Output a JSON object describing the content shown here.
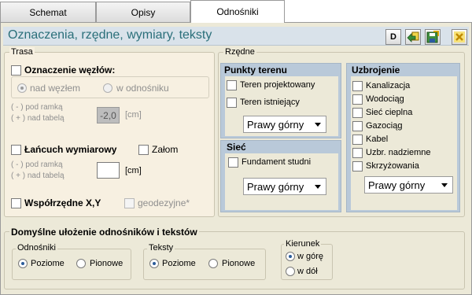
{
  "tabs": [
    {
      "label": "Schemat"
    },
    {
      "label": "Opisy"
    },
    {
      "label": "Odnośniki"
    }
  ],
  "header": {
    "title": "Oznaczenia, rzędne, wymiary, teksty",
    "btn_d": "D"
  },
  "trasa": {
    "label": "Trasa",
    "oznaczenie": "Oznaczenie węzłów:",
    "nad_wezlem": "nad węzłem",
    "w_odnosniku": "w odnośniku",
    "pod_ramka": "( - ) pod ramką",
    "nad_tabela": "( + ) nad tabelą",
    "value": "-2,0",
    "unit": "[cm]",
    "lancuch": "Łańcuch wymiarowy",
    "zalom": "Załom",
    "pod_ramka2": "( - ) pod ramką",
    "nad_tabela2": "( + ) nad tabelą",
    "value2": "",
    "unit2": "[cm]",
    "wspolrzedne": "Współrzędne X,Y",
    "geodezyjne": "geodezyjne*"
  },
  "rzedne": {
    "label": "Rzędne",
    "punkty": {
      "title": "Punkty terenu",
      "items": [
        "Teren projektowany",
        "Teren istniejący"
      ],
      "select": "Prawy górny"
    },
    "siec": {
      "title": "Sieć",
      "items": [
        "Fundament studni"
      ],
      "select": "Prawy górny"
    },
    "uzbrojenie": {
      "title": "Uzbrojenie",
      "items": [
        "Kanalizacja",
        "Wodociąg",
        "Sieć cieplna",
        "Gazociąg",
        "Kabel",
        "Uzbr. nadziemne",
        "Skrzyżowania"
      ],
      "select": "Prawy górny"
    }
  },
  "domyslne": {
    "label": "Domyślne ułożenie odnośników i tekstów",
    "odnosniki": {
      "label": "Odnośniki",
      "opt1": "Poziome",
      "opt2": "Pionowe"
    },
    "teksty": {
      "label": "Teksty",
      "opt1": "Poziome",
      "opt2": "Pionowe"
    },
    "kierunek": {
      "label": "Kierunek",
      "opt1": "w górę",
      "opt2": "w dół"
    }
  }
}
